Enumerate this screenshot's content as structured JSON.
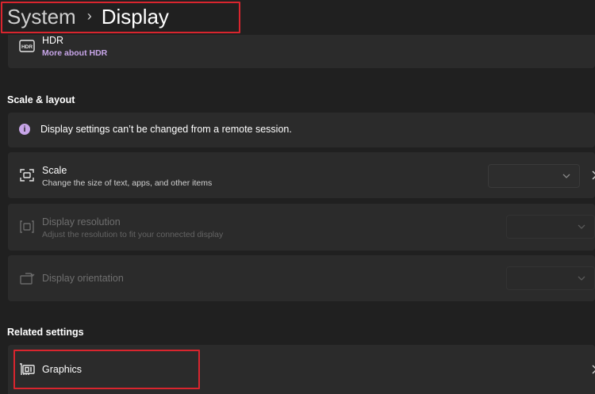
{
  "breadcrumb": {
    "parent": "System",
    "separator": "›",
    "current": "Display"
  },
  "hdr": {
    "title": "HDR",
    "link": "More about HDR",
    "icon": "hdr-icon"
  },
  "scale_layout": {
    "heading": "Scale & layout",
    "notice": "Display settings can’t be changed from a remote session.",
    "scale": {
      "title": "Scale",
      "subtitle": "Change the size of text, apps, and other items",
      "value": ""
    },
    "resolution": {
      "title": "Display resolution",
      "subtitle": "Adjust the resolution to fit your connected display",
      "value": ""
    },
    "orientation": {
      "title": "Display orientation",
      "value": ""
    }
  },
  "related": {
    "heading": "Related settings",
    "graphics": {
      "title": "Graphics",
      "icon": "graphics-card-icon"
    }
  },
  "colors": {
    "accent": "#c7a5e8",
    "highlight": "#d9252e",
    "background": "#202020",
    "card": "#2b2b2b"
  }
}
